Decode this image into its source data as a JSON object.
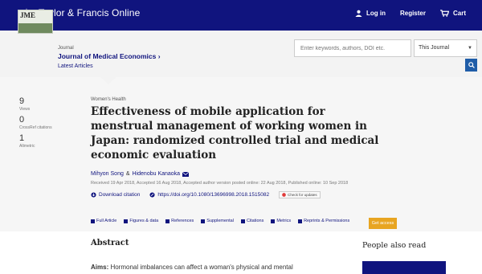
{
  "brand": {
    "name": "Taylor & Francis Online",
    "name_parts": [
      "Taylor",
      "&",
      "Francis Online"
    ]
  },
  "topnav": {
    "login": "Log in",
    "register": "Register",
    "cart": "Cart"
  },
  "journal": {
    "cover_text": "JME",
    "label": "Journal",
    "title": "Journal of Medical Economics ›",
    "latest": "Latest Articles"
  },
  "search": {
    "placeholder": "Enter keywords, authors, DOI etc.",
    "scope": "This Journal"
  },
  "metrics": [
    {
      "value": "9",
      "label": "Views"
    },
    {
      "value": "0",
      "label": "CrossRef citations"
    },
    {
      "value": "1",
      "label": "Altmetric"
    }
  ],
  "article": {
    "section": "Women's Health",
    "title": "Effectiveness of mobile application for menstrual management of working women in Japan: randomized controlled trial and medical economic evaluation",
    "author1": "Mihyon Song",
    "amp": "&",
    "author2": "Hidenobu Kanaoka",
    "dates": "Received 19 Apr 2018, Accepted 16 Aug 2018, Accepted author version posted online: 22 Aug 2018, Published online: 10 Sep 2018",
    "download": "Download citation",
    "doi": "https://doi.org/10.1080/13696998.2018.1515082",
    "crossmark": "Check for updates"
  },
  "tabs": [
    "Full Article",
    "Figures & data",
    "References",
    "Supplemental",
    "Citations",
    "Metrics",
    "Reprints & Permissions"
  ],
  "get_access": "Get access",
  "abstract": {
    "heading": "Abstract",
    "lead": "Aims:",
    "text": " Hormonal imbalances can affect a woman's physical and mental"
  },
  "people_also_read": "People also read",
  "colors": {
    "brand_navy": "#10147e",
    "accent_orange": "#e8a521",
    "search_blue": "#1f5da8"
  }
}
